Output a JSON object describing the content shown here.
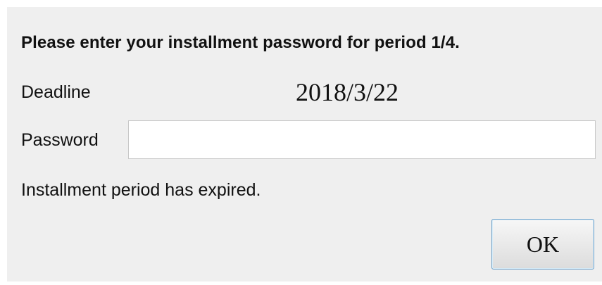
{
  "dialog": {
    "heading": "Please enter your installment password for period 1/4.",
    "deadline_label": "Deadline",
    "deadline_value": "2018/3/22",
    "password_label": "Password",
    "password_value": "",
    "password_placeholder": "",
    "status_message": "Installment period has expired.",
    "ok_label": "OK"
  },
  "colors": {
    "dialog_background": "#efefef",
    "button_border": "#6fa0c8"
  }
}
